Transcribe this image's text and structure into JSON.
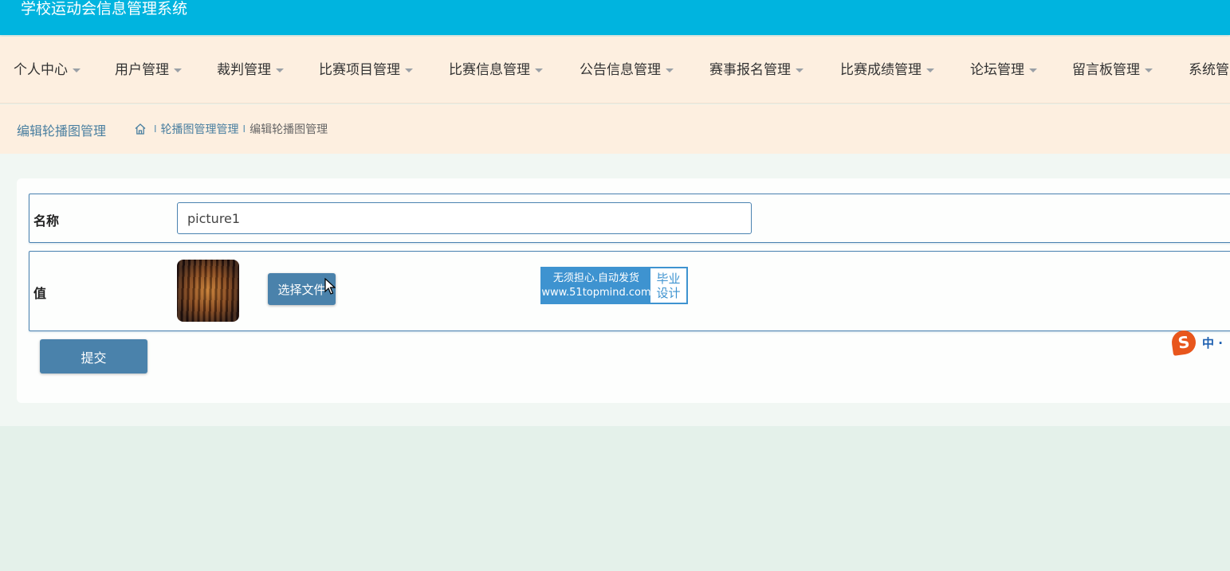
{
  "header": {
    "title": "学校运动会信息管理系统"
  },
  "nav": {
    "items": [
      {
        "label": "个人中心"
      },
      {
        "label": "用户管理"
      },
      {
        "label": "裁判管理"
      },
      {
        "label": "比赛项目管理"
      },
      {
        "label": "比赛信息管理"
      },
      {
        "label": "公告信息管理"
      },
      {
        "label": "赛事报名管理"
      },
      {
        "label": "比赛成绩管理"
      },
      {
        "label": "论坛管理"
      },
      {
        "label": "留言板管理"
      },
      {
        "label": "系统管"
      }
    ]
  },
  "breadcrumb": {
    "page_title": "编辑轮播图管理",
    "separator": "I",
    "parent": "轮播图管理管理",
    "current": "编辑轮播图管理"
  },
  "form": {
    "name_label": "名称",
    "name_value": "picture1",
    "value_label": "值",
    "file_button": "选择文件",
    "submit_button": "提交"
  },
  "watermark": {
    "slogan": "无须担心.自动发货",
    "url": "www.51topmind.com",
    "line1": "毕业",
    "line2": "设计"
  },
  "ime": {
    "logo": "S",
    "mode": "中 ·"
  },
  "colors": {
    "header_bg": "#00b4df",
    "nav_bg": "#fdefe0",
    "accent": "#4a82ab",
    "watermark_blue": "#3e93d0"
  }
}
